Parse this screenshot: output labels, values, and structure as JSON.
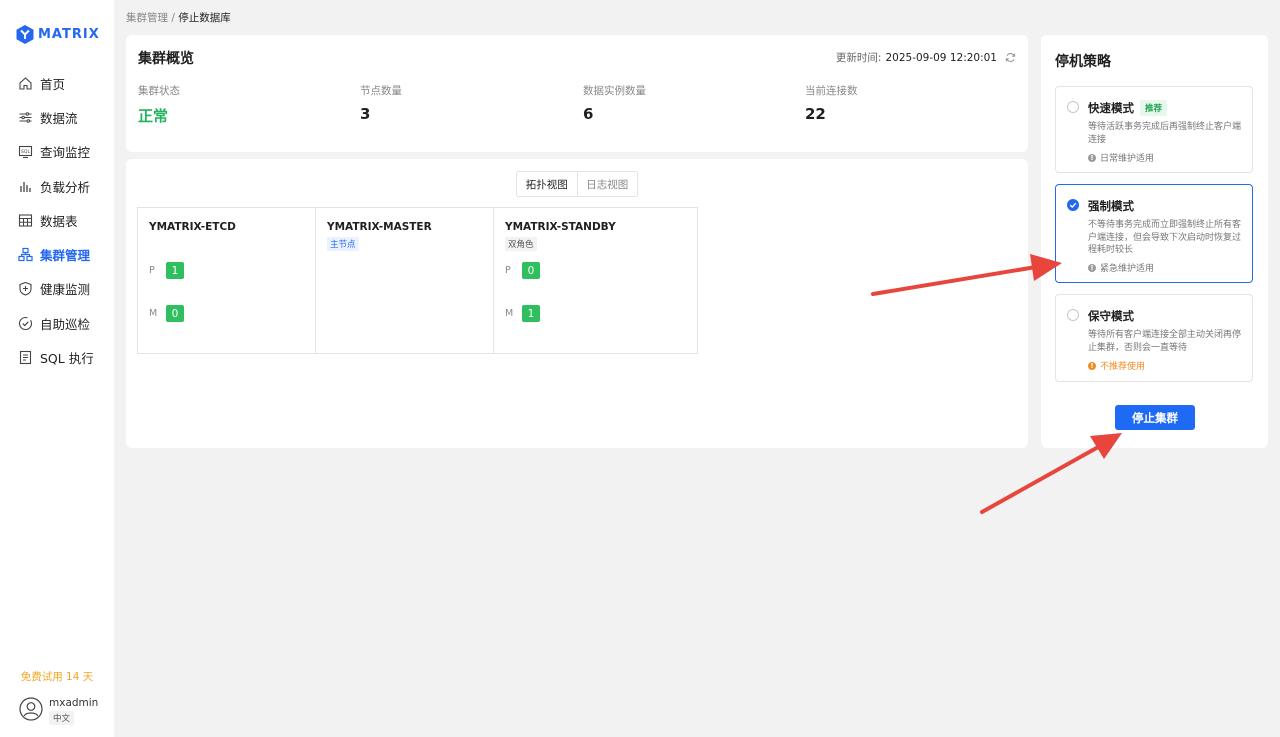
{
  "brand": {
    "name": "MATRIX",
    "color": "#2468f2"
  },
  "sidebar": {
    "items": [
      {
        "label": "首页",
        "icon": "home-icon",
        "active": false
      },
      {
        "label": "数据流",
        "icon": "dataflow-icon",
        "active": false
      },
      {
        "label": "查询监控",
        "icon": "sql-monitor-icon",
        "active": false
      },
      {
        "label": "负载分析",
        "icon": "bar-chart-icon",
        "active": false
      },
      {
        "label": "数据表",
        "icon": "table-icon",
        "active": false
      },
      {
        "label": "集群管理",
        "icon": "cluster-icon",
        "active": true
      },
      {
        "label": "健康监测",
        "icon": "shield-plus-icon",
        "active": false
      },
      {
        "label": "自助巡检",
        "icon": "check-circle-icon",
        "active": false
      },
      {
        "label": "SQL 执行",
        "icon": "sql-file-icon",
        "active": false
      }
    ],
    "trial": "免费试用 14 天",
    "user": {
      "name": "mxadmin",
      "lang": "中文"
    }
  },
  "breadcrumb": {
    "parent": "集群管理",
    "sep": "/",
    "current": "停止数据库"
  },
  "overview": {
    "title": "集群概览",
    "update_label": "更新时间:",
    "update_time": "2025-09-09 12:20:01",
    "stats": [
      {
        "label": "集群状态",
        "value": "正常"
      },
      {
        "label": "节点数量",
        "value": "3"
      },
      {
        "label": "数据实例数量",
        "value": "6"
      },
      {
        "label": "当前连接数",
        "value": "22"
      }
    ]
  },
  "topology": {
    "tabs": [
      "拓扑视图",
      "日志视图"
    ],
    "nodes": [
      {
        "name": "YMATRIX-ETCD",
        "tag": "",
        "p": "1",
        "m": "0"
      },
      {
        "name": "YMATRIX-MASTER",
        "tag": "主节点"
      },
      {
        "name": "YMATRIX-STANDBY",
        "tag": "双角色",
        "p": "0",
        "m": "1"
      }
    ],
    "p_label": "P",
    "m_label": "M"
  },
  "strategy": {
    "title": "停机策略",
    "options": [
      {
        "title": "快速模式",
        "badge": "推荐",
        "desc": "等待活跃事务完成后再强制终止客户端连接",
        "note": "日常维护适用",
        "selected": false
      },
      {
        "title": "强制模式",
        "desc": "不等待事务完成而立即强制终止所有客户端连接，但会导致下次启动时恢复过程耗时较长",
        "note": "紧急维护适用",
        "selected": true
      },
      {
        "title": "保守模式",
        "desc": "等待所有客户端连接全部主动关闭再停止集群，否则会一直等待",
        "note": "不推荐使用",
        "selected": false
      }
    ],
    "button": "停止集群"
  },
  "colors": {
    "ok": "#22b35e",
    "accent": "#1f6af5",
    "warn": "#f08c1e",
    "pill": "#2fbf5f",
    "arrow": "#e8453c"
  }
}
